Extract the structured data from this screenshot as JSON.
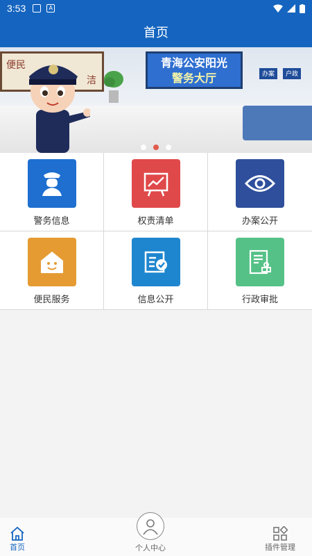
{
  "status_bar": {
    "time": "3:53"
  },
  "header": {
    "title": "首页"
  },
  "banner": {
    "left_sign_line1": "便民",
    "left_sign_line2": "洁",
    "screen_line1": "青海公安阳光",
    "screen_line2": "警务大厅",
    "desk_tag1": "办案",
    "desk_tag2": "户政",
    "dots": 3,
    "active_dot": 2
  },
  "grid": {
    "items": [
      {
        "label": "警务信息",
        "color": "#1e6fd0",
        "icon": "police-officer-icon"
      },
      {
        "label": "权责清单",
        "color": "#e0494a",
        "icon": "chart-board-icon"
      },
      {
        "label": "办案公开",
        "color": "#2f4f9c",
        "icon": "eye-icon"
      },
      {
        "label": "便民服务",
        "color": "#e59b32",
        "icon": "smiling-house-icon"
      },
      {
        "label": "信息公开",
        "color": "#1e86cf",
        "icon": "document-check-icon"
      },
      {
        "label": "行政审批",
        "color": "#55c187",
        "icon": "approval-document-icon"
      }
    ]
  },
  "bottom_nav": {
    "home": "首页",
    "profile": "个人中心",
    "plugins": "插件管理"
  }
}
